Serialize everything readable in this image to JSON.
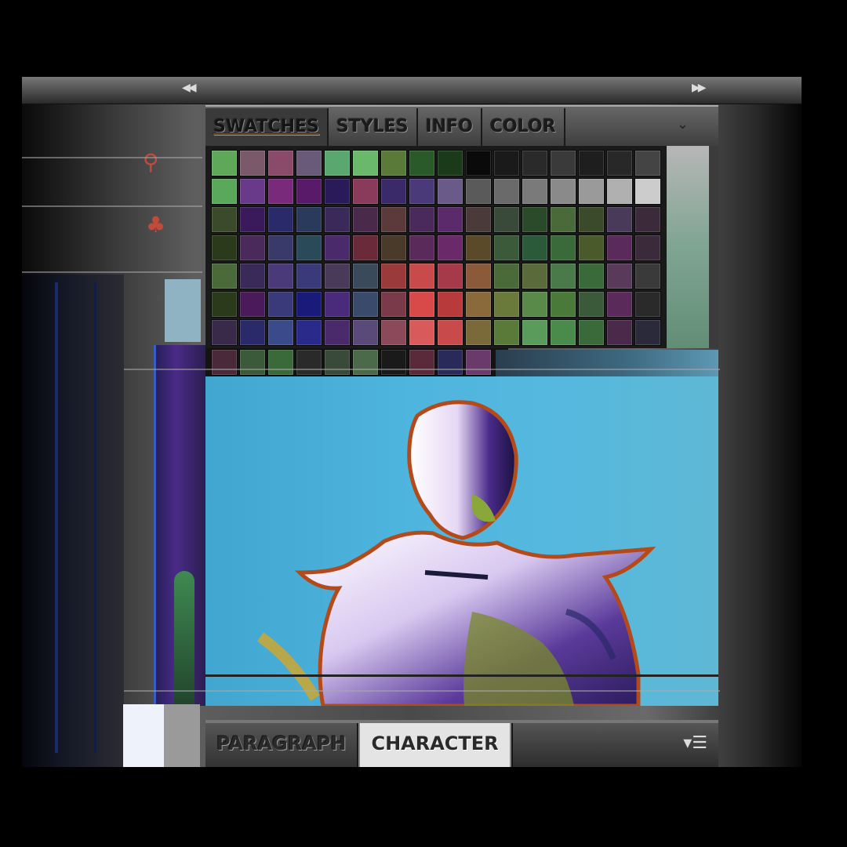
{
  "panel": {
    "collapse_icon": "double-chevron-left-icon",
    "expand_icon": "double-chevron-right-icon",
    "tabs": [
      {
        "label": "SWATCHES",
        "active": true
      },
      {
        "label": "STYLES",
        "active": false
      },
      {
        "label": "INFO",
        "active": false
      },
      {
        "label": "COLOR",
        "active": false
      }
    ],
    "tab_menu_icon": "panel-menu-icon"
  },
  "swatches": {
    "rows": [
      [
        "#5fa85a",
        "#7a5a6a",
        "#8a4a6a",
        "#6a5a7a",
        "#5aa870",
        "#6ab86a",
        "#5a7a3a",
        "#2a5a2a",
        "#1a3a1a",
        "#0a0a0a",
        "#1a1a1a",
        "#2a2a2a",
        "#3a3a3a",
        "#1e1e1e",
        "#282828",
        "#444444"
      ],
      [
        "#5aa85a",
        "#6a3a8a",
        "#7a2a7a",
        "#5a1a6a",
        "#2a1a5a",
        "#8a3a5a",
        "#3a2a6a",
        "#4a3a7a",
        "#6a5a8a",
        "#5a5a5a",
        "#6a6a6a",
        "#7a7a7a",
        "#8a8a8a",
        "#9a9a9a",
        "#b0b0b0",
        "#cccccc"
      ],
      [
        "#3a4a2a",
        "#3a1a5a",
        "#2a2a6a",
        "#2a3a5a",
        "#3a2a5a",
        "#4a2a4a",
        "#5a3a3a",
        "#4a2a5a",
        "#5a2a6a",
        "#4a3a3a",
        "#3a4a3a",
        "#2a4a2a",
        "#4a6a3a",
        "#3a4a2a",
        "#4a3a5a",
        "#3a2a3a"
      ],
      [
        "#2a3a1a",
        "#4a2a5a",
        "#3a3a6a",
        "#2a4a5a",
        "#4a2a6a",
        "#6a2a3a",
        "#4a3a2a",
        "#5a2a5a",
        "#6a2a6a",
        "#5a4a2a",
        "#3a5a3a",
        "#2a5a3a",
        "#3a6a3a",
        "#4a5a2a",
        "#5a2a5a",
        "#3a2a3a"
      ],
      [
        "#4a6a3a",
        "#3a2a5a",
        "#4a3a7a",
        "#3a3a7a",
        "#4a3a5a",
        "#3a4a5a",
        "#9a3a3a",
        "#c84a4a",
        "#a63a4a",
        "#8a5a3a",
        "#4a6a3a",
        "#5a6a3a",
        "#4a7a4a",
        "#3a6a3a",
        "#5a3a5a",
        "#3a3a3a"
      ],
      [
        "#2a3a1a",
        "#4a1a5a",
        "#3a3a7a",
        "#1a1a7a",
        "#4a2a7a",
        "#3a4a6a",
        "#7a3a4a",
        "#d84a4a",
        "#b83a3a",
        "#8a6a3a",
        "#6a7a3a",
        "#5a8a4a",
        "#4a7a3a",
        "#3a5a3a",
        "#5a2a5a",
        "#2a2a2a"
      ],
      [
        "#3a2a4a",
        "#2a2a6a",
        "#3a4a8a",
        "#2a2a8a",
        "#4a2a6a",
        "#5a4a7a",
        "#8a4a5a",
        "#d85a5a",
        "#c84a4a",
        "#7a6a3a",
        "#5a7a3a",
        "#5a9a5a",
        "#4a8a4a",
        "#3a6a3a",
        "#4a2a4a",
        "#2a2a3a"
      ]
    ],
    "extra_row": [
      "#4a2a3a",
      "#3a5a3a",
      "#3a6a3a",
      "#2a2a2a",
      "#3a4a3a",
      "#4a6a4a",
      "#1a1a1a",
      "#5a2a3a",
      "#2a2a5a",
      "#6a3a6a"
    ]
  },
  "bottom_panel": {
    "tabs": [
      {
        "label": "PARAGRAPH",
        "active": false
      },
      {
        "label": "CHARACTER",
        "active": true
      }
    ],
    "menu_icon": "panel-options-menu-icon"
  }
}
